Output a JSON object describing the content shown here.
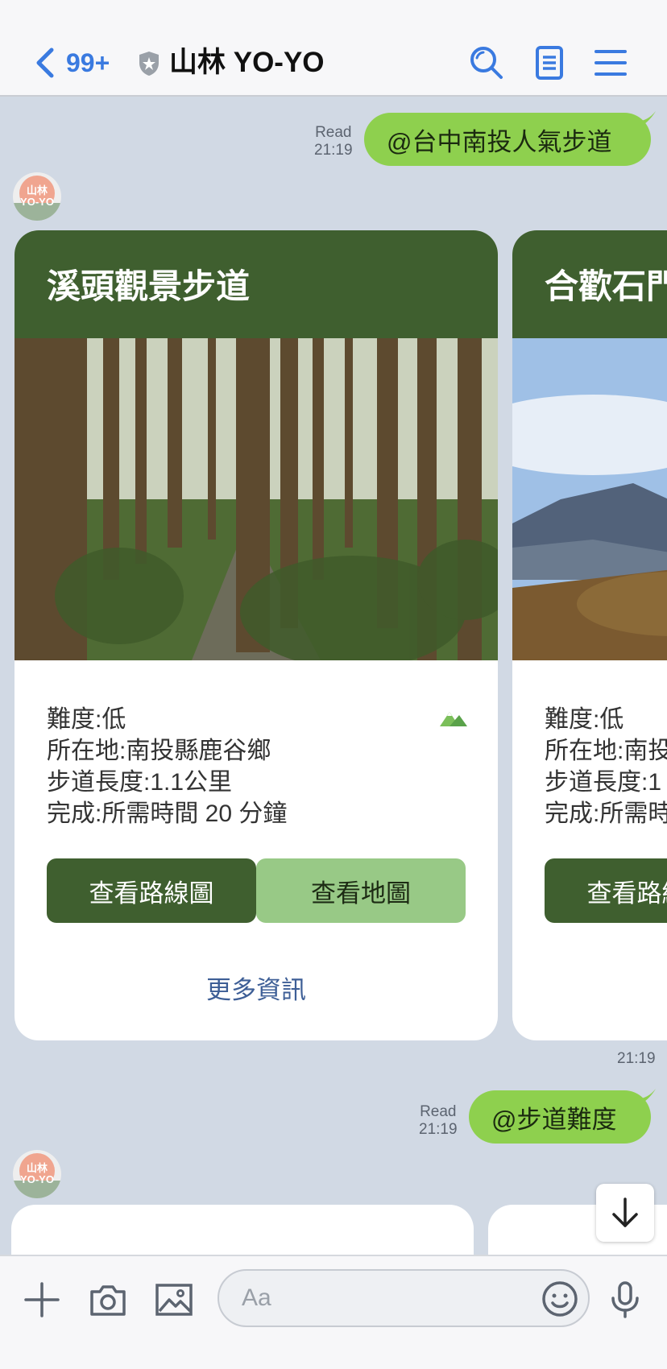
{
  "header": {
    "back_count": "99+",
    "title": "山林 YO-YO"
  },
  "messages": [
    {
      "read": "Read",
      "time": "21:19",
      "text": "@台中南投人氣步道"
    },
    {
      "read": "Read",
      "time": "21:19",
      "text": "@步道難度"
    }
  ],
  "avatar": {
    "line1": "山林",
    "line2": "YO-YO"
  },
  "carousel_time": "21:19",
  "cards": [
    {
      "title": "溪頭觀景步道",
      "difficulty": "難度:低",
      "location": "所在地:南投縣鹿谷鄉",
      "length": "步道長度:1.1公里",
      "duration": "完成:所需時間 20 分鐘",
      "btn_route": "查看路線圖",
      "btn_map": "查看地圖",
      "more": "更多資訊"
    },
    {
      "title": "合歡石門",
      "difficulty": "難度:低",
      "location": "所在地:南投",
      "length": "步道長度:1",
      "duration": "完成:所需時",
      "btn_route": "查看路線圖"
    }
  ],
  "input": {
    "placeholder": "Aa"
  },
  "colors": {
    "accent": "#3a7ae0",
    "bubble": "#8ed04e",
    "card_header": "#3f5f2f",
    "button_light": "#98c986",
    "background": "#d1d9e4"
  }
}
